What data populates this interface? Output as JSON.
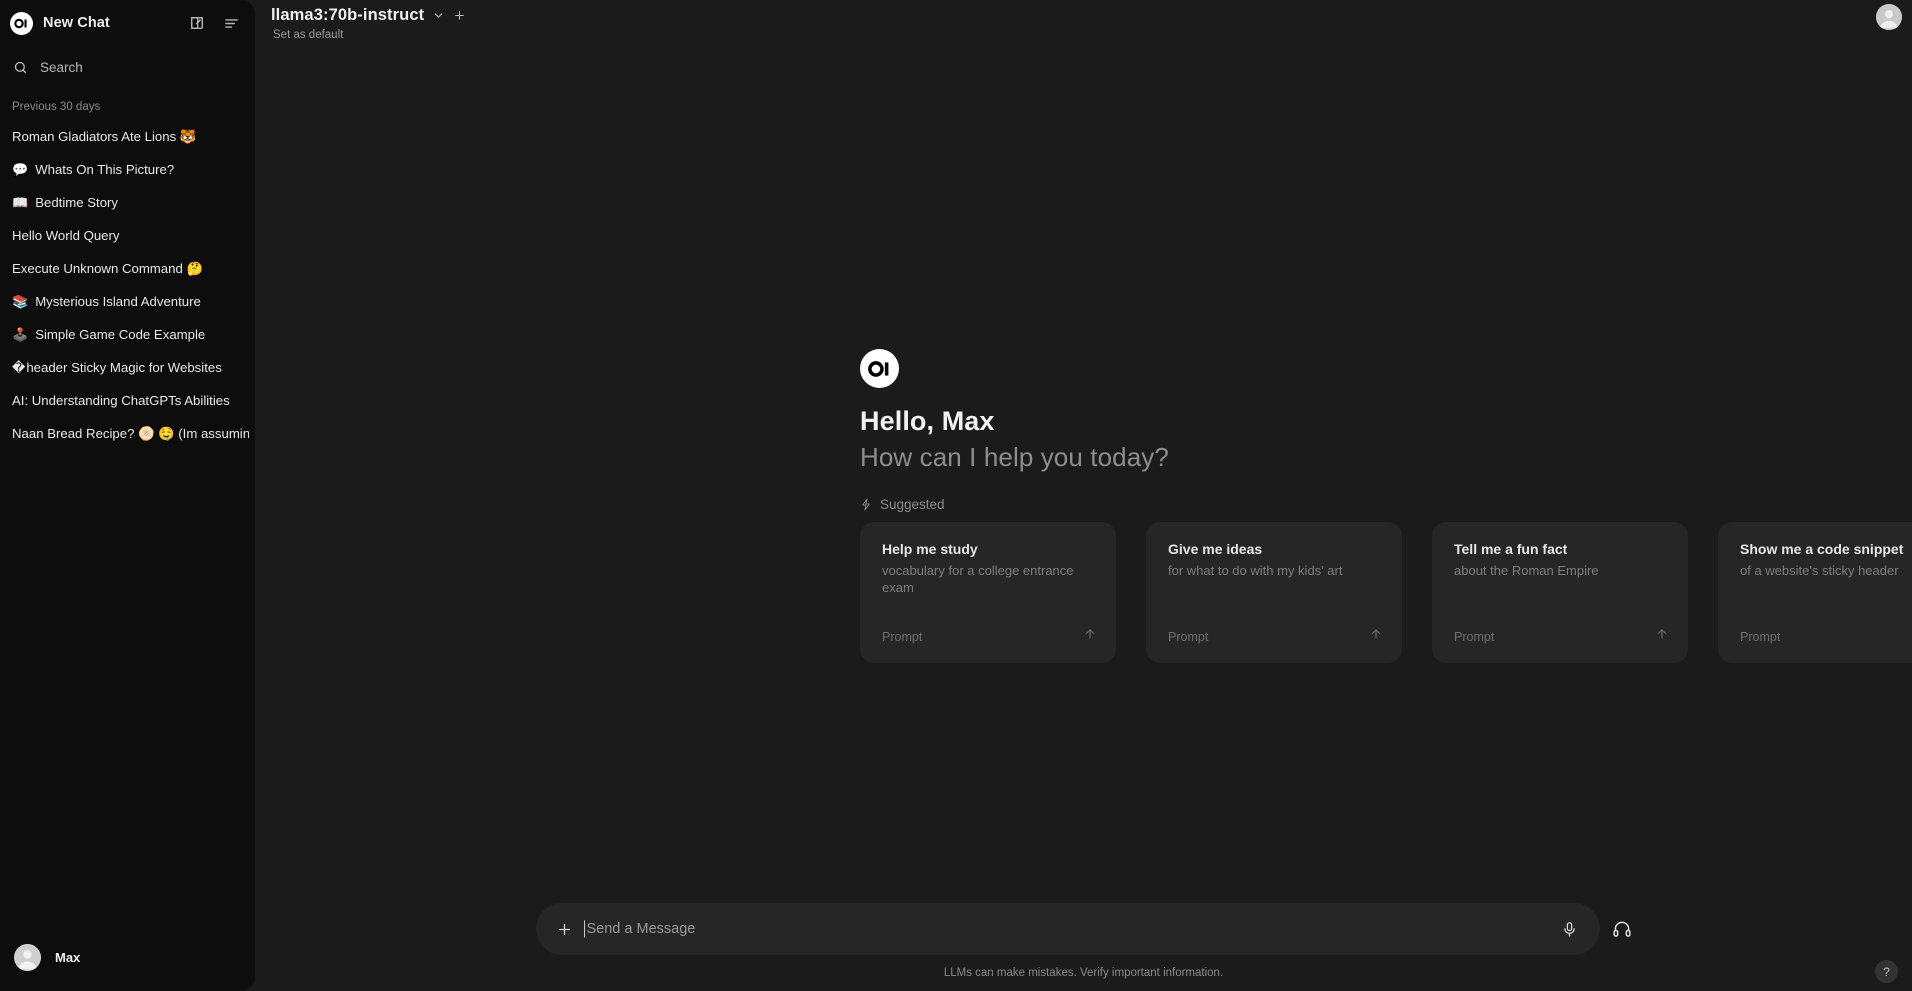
{
  "sidebar": {
    "logo_icon": "openwebui-logo",
    "title": "New Chat",
    "new_chat_icon": "pencil-square-icon",
    "panel_icon": "panel-toggle-icon",
    "search": {
      "icon": "search-icon",
      "placeholder": "Search",
      "label": "Search"
    },
    "group_label": "Previous 30 days",
    "items": [
      {
        "emoji": "",
        "label": "Roman Gladiators Ate Lions 🐯"
      },
      {
        "emoji": "💬",
        "label": "Whats On This Picture?"
      },
      {
        "emoji": "📖",
        "label": "Bedtime Story"
      },
      {
        "emoji": "",
        "label": "Hello World Query"
      },
      {
        "emoji": "",
        "label": "Execute Unknown Command 🤔"
      },
      {
        "emoji": "📚",
        "label": "Mysterious Island Adventure"
      },
      {
        "emoji": "🕹️",
        "label": "Simple Game Code Example"
      },
      {
        "emoji": "�",
        "label": "header Sticky Magic for Websites"
      },
      {
        "emoji": "",
        "label": "AI: Understanding ChatGPTs Abilities"
      },
      {
        "emoji": "",
        "label": "Naan Bread Recipe? 🫓 🤤 (Im assuming)"
      }
    ],
    "user": {
      "avatar_icon": "user-avatar",
      "name": "Max"
    }
  },
  "header": {
    "model_name": "llama3:70b-instruct",
    "chevron_icon": "chevron-down-icon",
    "add_icon": "plus-icon",
    "set_default": "Set as default",
    "avatar_icon": "user-avatar"
  },
  "greeting": {
    "logo_icon": "openwebui-logo",
    "hello": "Hello, Max",
    "question": "How can I help you today?",
    "suggested_icon": "sparkle-icon",
    "suggested_label": "Suggested"
  },
  "suggestions": [
    {
      "title": "Help me study",
      "subtitle": "vocabulary for a college entrance exam",
      "prompt_label": "Prompt",
      "arrow_icon": "arrow-up-icon"
    },
    {
      "title": "Give me ideas",
      "subtitle": "for what to do with my kids' art",
      "prompt_label": "Prompt",
      "arrow_icon": "arrow-up-icon"
    },
    {
      "title": "Tell me a fun fact",
      "subtitle": "about the Roman Empire",
      "prompt_label": "Prompt",
      "arrow_icon": "arrow-up-icon"
    },
    {
      "title": "Show me a code snippet",
      "subtitle": "of a website's sticky header",
      "prompt_label": "Prompt",
      "arrow_icon": "arrow-up-icon"
    }
  ],
  "composer": {
    "plus_icon": "plus-icon",
    "placeholder": "Send a Message",
    "value": "",
    "mic_icon": "microphone-icon",
    "headset_icon": "headphones-icon",
    "disclaimer": "LLMs can make mistakes. Verify important information."
  },
  "help": {
    "label": "?",
    "icon": "question-mark-icon"
  },
  "colors": {
    "app_bg": "#1b1b1b",
    "sidebar_bg": "#0d0d0d",
    "card_bg": "#262626",
    "text_primary": "#ededed",
    "text_muted": "#8d8d8d"
  }
}
